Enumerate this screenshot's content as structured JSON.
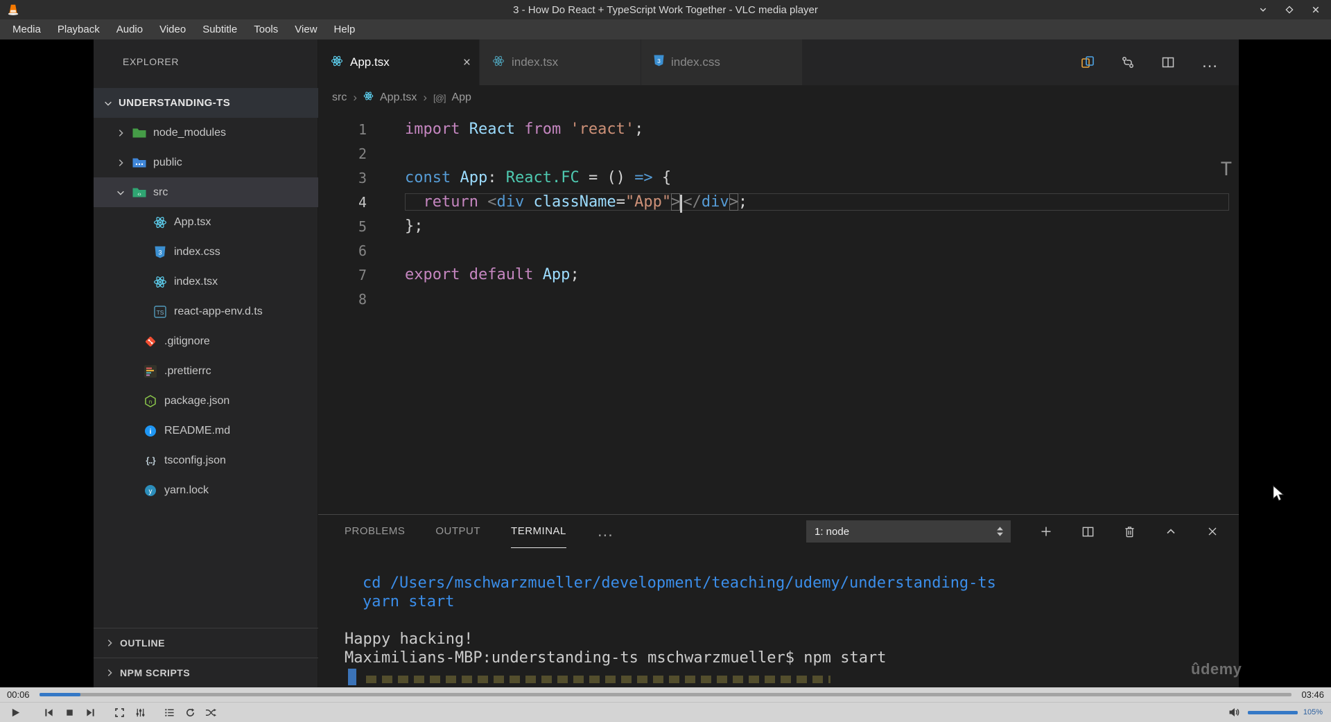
{
  "vlc": {
    "title": "3 - How Do React + TypeScript Work Together - VLC media player",
    "menu_items": [
      "Media",
      "Playback",
      "Audio",
      "Video",
      "Subtitle",
      "Tools",
      "View",
      "Help"
    ],
    "time_elapsed": "00:06",
    "time_total": "03:46",
    "progress_percent": 3.3,
    "volume_percent": "105%"
  },
  "glyphs": {
    "close": "×",
    "more": "…",
    "breadcrumb_sep": "›",
    "symbol": "[@]",
    "braces_icon": "{..}",
    "minimap_char": "T"
  },
  "explorer": {
    "title": "EXPLORER",
    "root_label": "UNDERSTANDING-TS",
    "rows": [
      {
        "label": "node_modules"
      },
      {
        "label": "public"
      },
      {
        "label": "src"
      },
      {
        "label": "App.tsx"
      },
      {
        "label": "index.css"
      },
      {
        "label": "index.tsx"
      },
      {
        "label": "react-app-env.d.ts"
      },
      {
        "label": ".gitignore"
      },
      {
        "label": ".prettierrc"
      },
      {
        "label": "package.json"
      },
      {
        "label": "README.md"
      },
      {
        "label": "tsconfig.json"
      },
      {
        "label": "yarn.lock"
      }
    ],
    "sections": [
      "OUTLINE",
      "NPM SCRIPTS"
    ]
  },
  "tabs": [
    {
      "label": "App.tsx"
    },
    {
      "label": "index.tsx"
    },
    {
      "label": "index.css"
    }
  ],
  "breadcrumb": [
    "src",
    "App.tsx",
    "App"
  ],
  "editor": {
    "line_numbers": [
      "1",
      "2",
      "3",
      "4",
      "5",
      "6",
      "7",
      "8"
    ],
    "code": {
      "l1": [
        "import ",
        "React ",
        "from ",
        "'react'",
        ";"
      ],
      "l3": [
        "const ",
        "App",
        ": ",
        "React.FC",
        " = () ",
        "=>",
        " {"
      ],
      "l4a": [
        "  ",
        "return ",
        "<",
        "div",
        " ",
        "className",
        "=",
        "\"App\""
      ],
      "l4_gt1": ">",
      "l4b": [
        "</",
        "div"
      ],
      "l4_gt2": ">",
      "l4_semi": ";",
      "l5": "};",
      "l7": [
        "export default ",
        "App",
        ";"
      ]
    }
  },
  "panel": {
    "tabs": [
      "PROBLEMS",
      "OUTPUT",
      "TERMINAL"
    ],
    "shell_selector": "1: node",
    "terminal": {
      "cmd1": "cd /Users/mschwarzmueller/development/teaching/udemy/understanding-ts",
      "cmd2": "yarn start",
      "out1": "Happy hacking!",
      "out2": "Maximilians-MBP:understanding-ts mschwarzmueller$ npm start"
    },
    "watermark": "ûdemy"
  }
}
